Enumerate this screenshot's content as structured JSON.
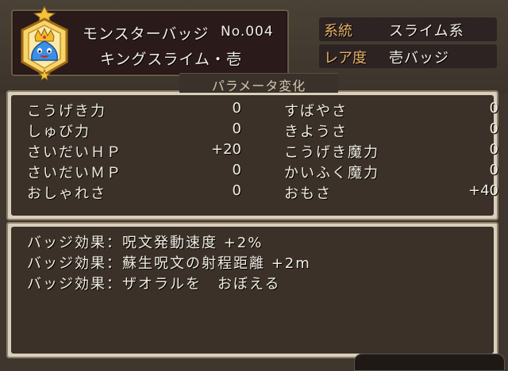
{
  "header": {
    "badge_name": "モンスターバッジ",
    "number": "No.004",
    "monster_name": "キングスライム・壱",
    "badge_icon": "king-slime-badge-icon"
  },
  "info": {
    "family_label": "系統",
    "family_value": "スライム系",
    "rarity_label": "レア度",
    "rarity_value": "壱バッジ"
  },
  "params": {
    "title": "パラメータ変化",
    "left": [
      {
        "label": "こうげき力",
        "value": "0"
      },
      {
        "label": "しゅび力",
        "value": "0"
      },
      {
        "label": "さいだいＨＰ",
        "value": "+20"
      },
      {
        "label": "さいだいＭＰ",
        "value": "0"
      },
      {
        "label": "おしゃれさ",
        "value": "0"
      }
    ],
    "right": [
      {
        "label": "すばやさ",
        "value": "0"
      },
      {
        "label": "きようさ",
        "value": "0"
      },
      {
        "label": "こうげき魔力",
        "value": "0"
      },
      {
        "label": "かいふく魔力",
        "value": "0"
      },
      {
        "label": "おもさ",
        "value": "+40"
      }
    ]
  },
  "effects": [
    "バッジ効果：呪文発動速度 +2%",
    "バッジ効果：蘇生呪文の射程距離 +2m",
    "バッジ効果：ザオラルを　おぼえる"
  ],
  "colors": {
    "label_accent": "#e9b46a",
    "panel_bg": "#3b3128",
    "text": "#f2eee4"
  }
}
